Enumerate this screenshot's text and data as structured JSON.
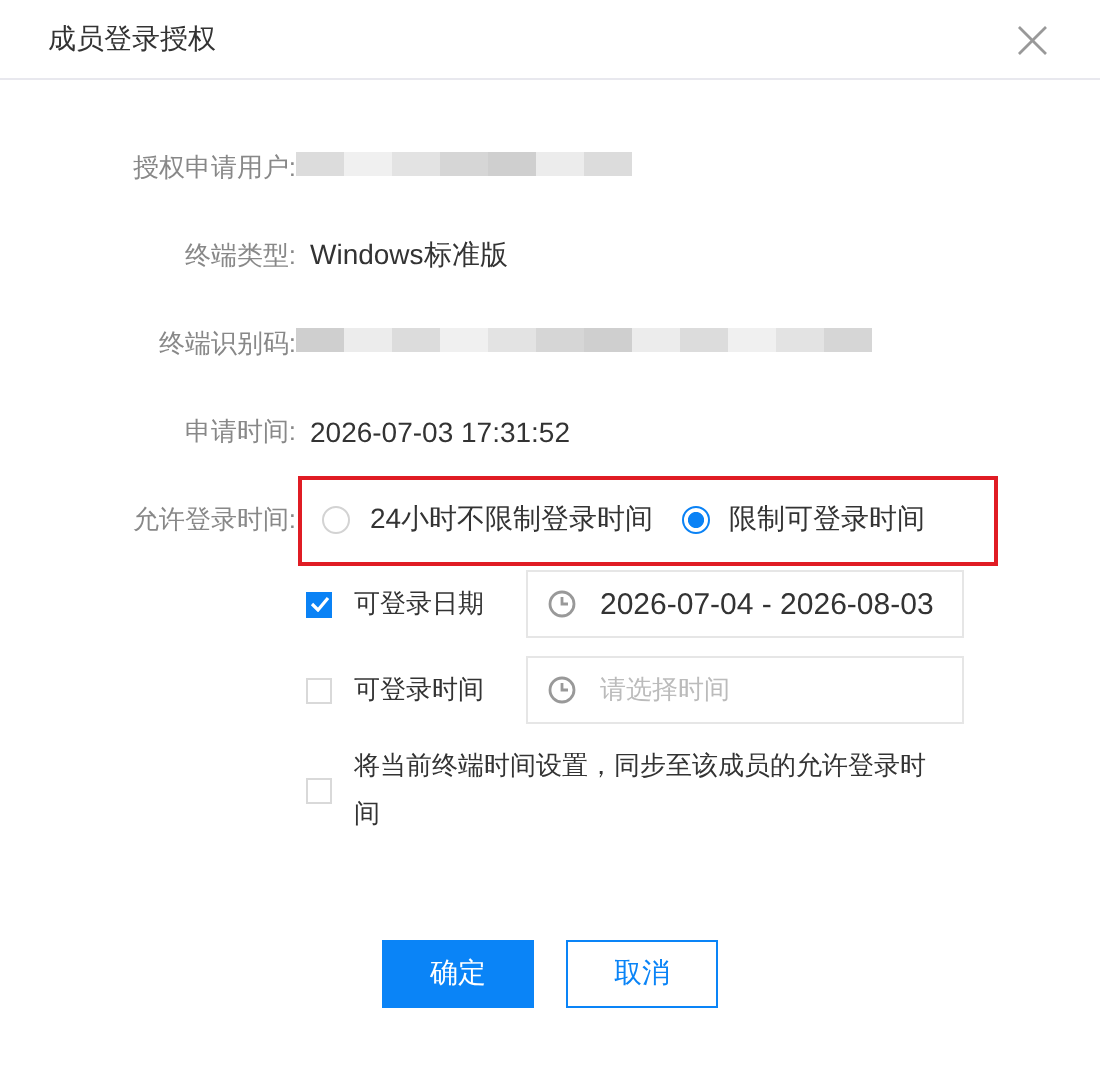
{
  "dialog": {
    "title": "成员登录授权",
    "close": "×"
  },
  "fields": [
    {
      "label": "授权申请用户:",
      "kind": "redacted"
    },
    {
      "label": "终端类型:",
      "kind": "text",
      "value": "Windows标准版"
    },
    {
      "label": "终端识别码:",
      "kind": "redacted"
    },
    {
      "label": "申请时间:",
      "kind": "text",
      "value": "2026-07-03 17:31:52"
    }
  ],
  "login_time": {
    "label": "允许登录时间:",
    "highlighted": true,
    "options": [
      {
        "label": "24小时不限制登录时间",
        "selected": false
      },
      {
        "label": "限制可登录时间",
        "selected": true
      }
    ]
  },
  "limits": [
    {
      "label": "可登录日期",
      "checked": true,
      "kind": "picker",
      "value": "2026-07-04 - 2026-08-03"
    },
    {
      "label": "可登录时间",
      "checked": false,
      "kind": "picker",
      "placeholder": "请选择时间"
    },
    {
      "label": "将当前终端时间设置，同步至该成员的允许登录时间",
      "checked": false,
      "kind": "plain"
    }
  ],
  "buttons": [
    {
      "label": "确定",
      "kind": "primary"
    },
    {
      "label": "取消",
      "kind": "secondary"
    }
  ]
}
